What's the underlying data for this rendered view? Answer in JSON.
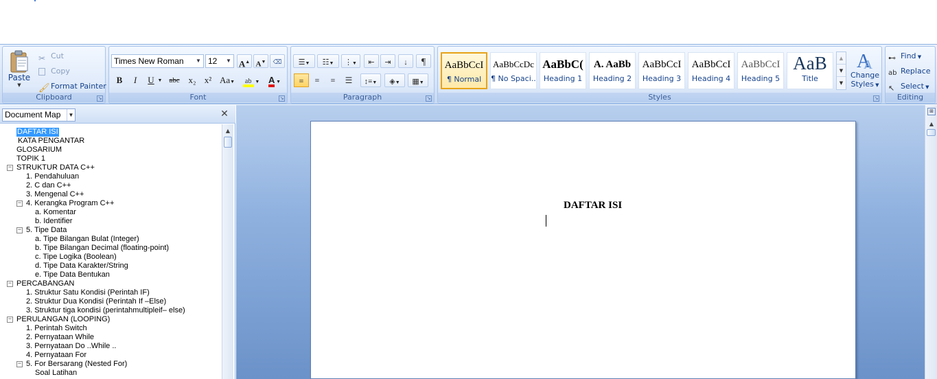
{
  "clipboard": {
    "paste": "Paste",
    "cut": "Cut",
    "copy": "Copy",
    "format_painter": "Format Painter",
    "label": "Clipboard"
  },
  "font": {
    "family": "Times New Roman",
    "size": "12",
    "grow": "A",
    "shrink": "A",
    "bold": "B",
    "italic": "I",
    "underline": "U",
    "strike": "abc",
    "subscript": "x₂",
    "superscript": "x²",
    "change_case": "Aa",
    "color": "A",
    "label": "Font"
  },
  "paragraph": {
    "label": "Paragraph"
  },
  "styles": {
    "label": "Styles",
    "items": [
      {
        "sample": "AaBbCcI",
        "name": "¶ Normal"
      },
      {
        "sample": "AaBbCcDc",
        "name": "¶ No Spaci..."
      },
      {
        "sample": "AaBbC(",
        "name": "Heading 1"
      },
      {
        "sample": "A. AaBb",
        "name": "Heading 2"
      },
      {
        "sample": "AaBbCcI",
        "name": "Heading 3"
      },
      {
        "sample": "AaBbCcI",
        "name": "Heading 4"
      },
      {
        "sample": "AaBbCcI",
        "name": "Heading 5"
      },
      {
        "sample": "AaB",
        "name": "Title"
      }
    ],
    "change_styles_1": "Change",
    "change_styles_2": "Styles"
  },
  "editing": {
    "label": "Editing",
    "find": "Find",
    "replace": "Replace",
    "select": "Select"
  },
  "docmap": {
    "view": "Document Map",
    "items": [
      "DAFTAR ISI",
      "KATA PENGANTAR",
      "GLOSARIUM",
      "TOPIK 1",
      "STRUKTUR DATA C++",
      "1. Pendahuluan",
      "2. C dan C++",
      "3. Mengenal C++",
      "4. Kerangka Program C++",
      "a. Komentar",
      "b. Identifier",
      "5. Tipe Data",
      "a. Tipe Bilangan Bulat (Integer)",
      "b. Tipe Bilangan Decimal (floating-point)",
      "c. Tipe Logika (Boolean)",
      "d. Tipe Data Karakter/String",
      "e. Tipe Data Bentukan",
      "PERCABANGAN",
      "1. Struktur Satu Kondisi (Perintah IF)",
      "2. Struktur Dua Kondisi (Perintah If –Else)",
      "3. Struktur tiga kondisi (perintahmultipleif– else)",
      "PERULANGAN (LOOPING)",
      "1. Perintah Switch",
      "2. Pernyataan While",
      "3. Pernyataan Do ..While ..",
      "4. Pernyataan For",
      "5. For Bersarang (Nested For)",
      "Soal Latihan"
    ]
  },
  "document": {
    "heading": "DAFTAR ISI"
  }
}
